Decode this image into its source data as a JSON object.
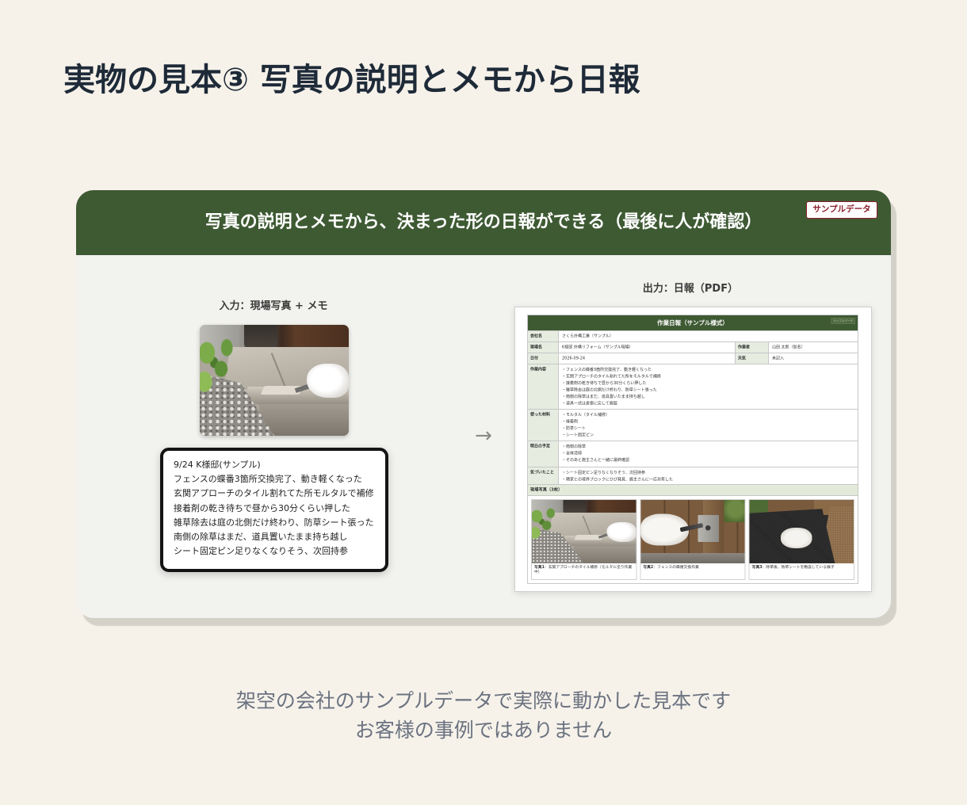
{
  "page": {
    "title": "実物の見本③ 写真の説明とメモから日報"
  },
  "colors": {
    "background": "#f6f2ea",
    "accent_green": "#3e5a33",
    "badge_red": "#8a1f2c",
    "title_text": "#1e2a38",
    "footer_text": "#6b7280"
  },
  "card": {
    "header_title": "写真の説明とメモから、決まった形の日報ができる（最後に人が確認）",
    "badge": "サンプルデータ"
  },
  "input": {
    "label": "入力：現場写真 + メモ",
    "memo_lines": [
      "9/24 K様邸(サンプル)",
      "フェンスの蝶番3箇所交換完了、動き軽くなった",
      "玄関アプローチのタイル割れてた所モルタルで補修",
      "接着剤の乾き待ちで昼から30分くらい押した",
      "雑草除去は庭の北側だけ終わり、防草シート張った",
      "南側の除草はまだ、道具置いたまま持ち越し",
      "シート固定ピン足りなくなりそう、次回持参"
    ]
  },
  "arrow": {
    "glyph": "→",
    "icon": "arrow-right-icon"
  },
  "output": {
    "label": "出力：日報（PDF）",
    "report": {
      "title": "作業日報（サンプル様式）",
      "stamp": "サンプルデータ",
      "rows": {
        "company": {
          "label": "会社名",
          "value": "さくら外構工業（サンプル）"
        },
        "site": {
          "label": "現場名",
          "value": "K様邸 外構リフォーム（サンプル現場）"
        },
        "worker": {
          "label": "作業者",
          "value": "山田 太郎（仮名）"
        },
        "date": {
          "label": "日付",
          "value": "2026-09-24"
        },
        "weather": {
          "label": "天気",
          "value": "未記入"
        },
        "work": {
          "label": "作業内容",
          "items": [
            "・フェンスの蝶番3箇所交換完了、動き軽くなった",
            "・玄関アプローチのタイル割れてた所をモルタルで補修",
            "・接着剤の乾き待ちで昼から30分くらい押した",
            "・雑草除去は庭の北側だけ終わり、防草シート張った",
            "・南側の除草はまだ、道具置いたまま持ち越し",
            "・道具一式は倉庫に戻して施錠"
          ]
        },
        "materials": {
          "label": "使った材料",
          "items": [
            "・モルタル（タイル補修）",
            "・接着剤",
            "・防草シート",
            "・シート固定ピン"
          ]
        },
        "tomorrow": {
          "label": "明日の予定",
          "items": [
            "・南側の除草",
            "・全体清掃",
            "・そのあと施主さんと一緒に最終確認"
          ]
        },
        "notes": {
          "label": "気づいたこと",
          "items": [
            "・シート固定ピン足りなくなりそう、次回持参",
            "・隣家との境界ブロックにひび発見、施主さんに一応共有した"
          ]
        }
      },
      "photos": {
        "heading": "現場写真（3枚）",
        "items": [
          {
            "label": "写真1",
            "text": "：玄関アプローチのタイル補修（モルタル塗り作業中）"
          },
          {
            "label": "写真2",
            "text": "：フェンスの蝶番交換作業"
          },
          {
            "label": "写真3",
            "text": "：除草後、防草シートを敷設している様子"
          }
        ]
      }
    }
  },
  "footer": {
    "lines": [
      "架空の会社のサンプルデータで実際に動かした見本です",
      "お客様の事例ではありません"
    ]
  }
}
